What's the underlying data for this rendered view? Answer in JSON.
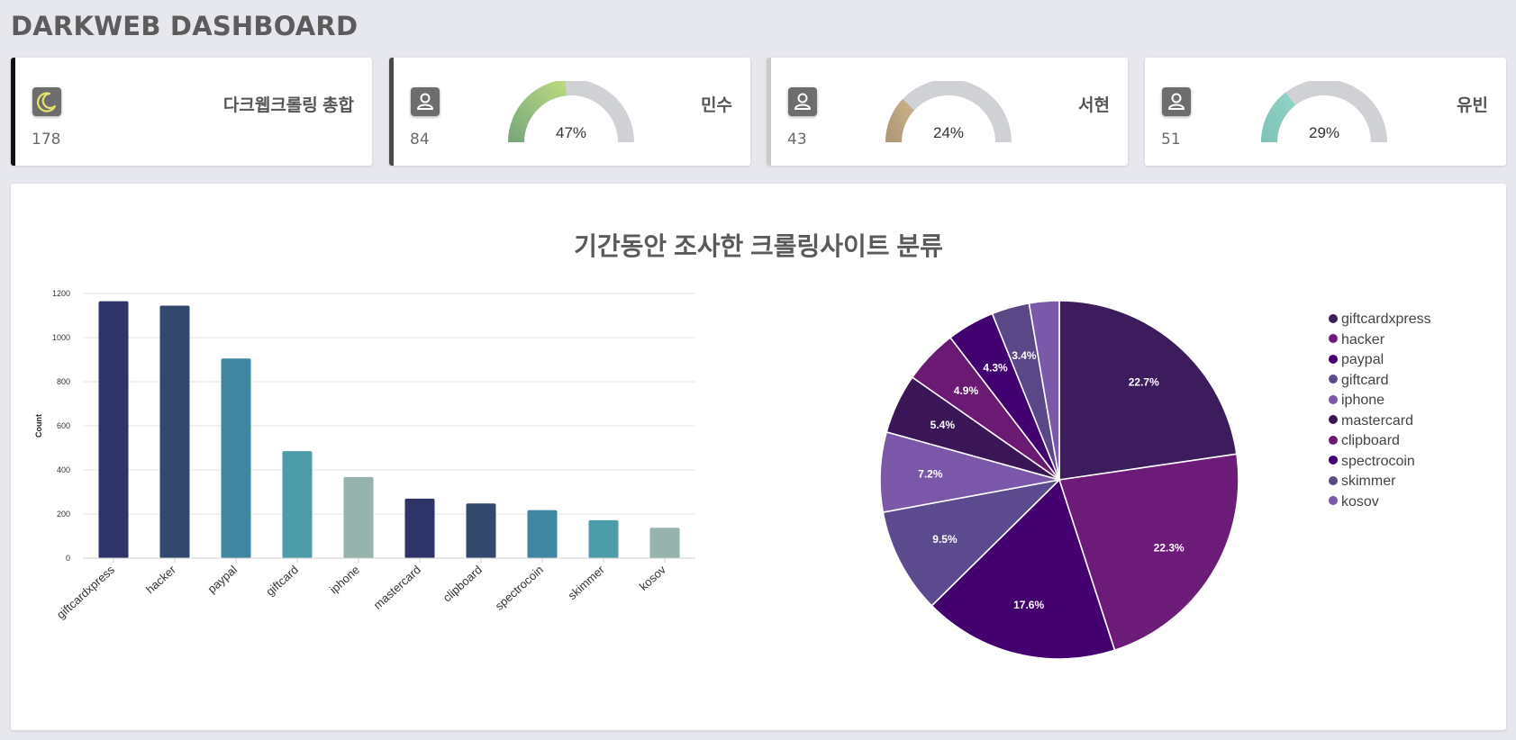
{
  "header": {
    "title": "DARKWEB DASHBOARD"
  },
  "cards": [
    {
      "name": "다크웹크롤링 총합",
      "value": "178",
      "icon": "moon-icon",
      "bar_color": "#111111"
    },
    {
      "name": "민수",
      "value": "84",
      "icon": "user-icon",
      "bar_color": "#4a4a4a",
      "gauge": {
        "percent_label": "47%",
        "fraction": 0.47,
        "color_start": "#7aaa7c",
        "color_end": "#b9d77e"
      }
    },
    {
      "name": "서현",
      "value": "43",
      "icon": "user-icon",
      "bar_color": "#c9c9c9",
      "gauge": {
        "percent_label": "24%",
        "fraction": 0.24,
        "color_start": "#b09a78",
        "color_end": "#c7ae85"
      }
    },
    {
      "name": "유빈",
      "value": "51",
      "icon": "user-icon",
      "bar_color": "#ffffff",
      "gauge": {
        "percent_label": "29%",
        "fraction": 0.29,
        "color_start": "#7fc5b9",
        "color_end": "#8fd1c4"
      }
    }
  ],
  "panel": {
    "title": "기간동안 조사한 크롤링사이트 분류"
  },
  "chart_data": [
    {
      "type": "bar",
      "ylabel": "Count",
      "ylim": [
        0,
        1200
      ],
      "yticks": [
        "0",
        "200",
        "400",
        "600",
        "800",
        "1000",
        "1200"
      ],
      "grid": true,
      "categories": [
        "giftcardxpress",
        "hacker",
        "paypal",
        "giftcard",
        "iphone",
        "mastercard",
        "clipboard",
        "spectrocoin",
        "skimmer",
        "kosov"
      ],
      "values": [
        1165,
        1145,
        905,
        485,
        368,
        270,
        248,
        218,
        172,
        138
      ],
      "colors": [
        "#2e3468",
        "#33486d",
        "#3f86a0",
        "#4c9caa",
        "#96b3ad",
        "#2e3468",
        "#33486d",
        "#3f86a0",
        "#4c9caa",
        "#96b3ad"
      ]
    },
    {
      "type": "pie",
      "labels": [
        "giftcardxpress",
        "hacker",
        "paypal",
        "giftcard",
        "iphone",
        "mastercard",
        "clipboard",
        "spectrocoin",
        "skimmer",
        "kosov"
      ],
      "values": [
        22.7,
        22.3,
        17.6,
        9.5,
        7.2,
        5.4,
        4.9,
        4.3,
        3.4,
        2.7
      ],
      "value_labels": [
        "22.7%",
        "22.3%",
        "17.6%",
        "9.5%",
        "7.2%",
        "5.4%",
        "4.9%",
        "4.3%",
        "3.4%",
        ""
      ],
      "colors": [
        "#3d1c5e",
        "#6d1b78",
        "#43006e",
        "#5b4a8e",
        "#7a57a8",
        "#3a1657",
        "#6b1a74",
        "#410170",
        "#594787",
        "#7a58aa"
      ],
      "legend_position": "right"
    }
  ]
}
